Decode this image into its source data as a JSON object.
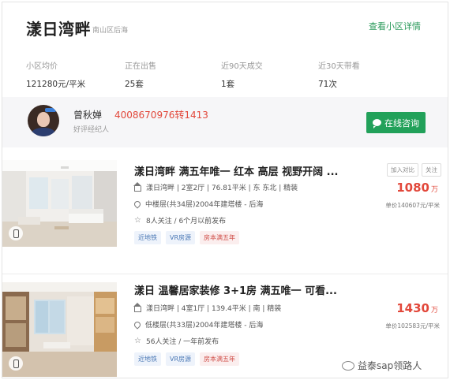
{
  "header": {
    "title": "漾日湾畔",
    "subtitle": "南山区后海",
    "detail_link": "查看小区详情"
  },
  "stats": [
    {
      "label": "小区均价",
      "value": "121280元/平米"
    },
    {
      "label": "正在出售",
      "value": "25套"
    },
    {
      "label": "近90天成交",
      "value": "1套"
    },
    {
      "label": "近30天带看",
      "value": "71次"
    }
  ],
  "agent": {
    "name": "曾秋婵",
    "phone": "4008670976转1413",
    "role": "好评经纪人",
    "consult_label": "在线咨询"
  },
  "listings": [
    {
      "title": "漾日湾畔 满五年唯一 红本 高层 视野开阔 ...",
      "info_line": "漾日湾畔  |  2室2厅  |  76.81平米  |  东 东北  |  精装",
      "floor_line": "中楼层(共34层)2004年建塔楼 - 后海",
      "follow_line": "8人关注 / 6个月以前发布",
      "tags": [
        "近地铁",
        "VR房源",
        "房本满五年"
      ],
      "actions": [
        "加入对比",
        "关注"
      ],
      "price": "1080",
      "price_unit": "万",
      "unit_price": "单价140607元/平米"
    },
    {
      "title": "漾日 温馨居家装修 3+1房 满五唯一 可看...",
      "info_line": "漾日湾畔  |  4室1厅  |  139.4平米  |  南  |  精装",
      "floor_line": "低楼层(共33层)2004年建塔楼 - 后海",
      "follow_line": "56人关注 / 一年前发布",
      "tags": [
        "近地铁",
        "VR房源",
        "房本满五年"
      ],
      "actions": [],
      "price": "1430",
      "price_unit": "万",
      "unit_price": "单价102583元/平米"
    }
  ],
  "watermark": "益泰sap领路人",
  "colors": {
    "accent_green": "#22a15a",
    "price_red": "#e2483b"
  }
}
